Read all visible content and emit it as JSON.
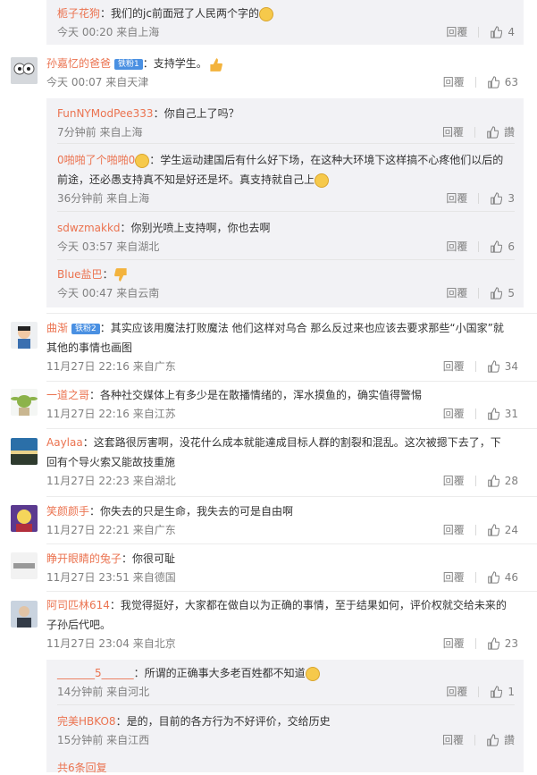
{
  "labels": {
    "reply": "回覆"
  },
  "colors": {
    "username": "#eb7350",
    "badge": "#4a90e2",
    "meta": "#808080"
  },
  "comments": [
    {
      "user": "栀子花狗",
      "text": "：我们的jc前面冠了人民两个字的",
      "time": "今天 00:20",
      "from": "来自上海",
      "likes": "4",
      "emoji": "smirk"
    },
    {
      "user": "孙嘉忆的爸爸",
      "badge": "铁粉1",
      "text": "：支持学生。",
      "time": "今天 00:07",
      "from": "来自天津",
      "likes": "63",
      "emoji": "thumbs-up",
      "replies": [
        {
          "user": "FunNYModPee333",
          "text": "：你自己上了吗？",
          "time": "7分钟前",
          "from": "来自上海",
          "likes": "讚"
        },
        {
          "user": "0啪啪了个啪啪0",
          "text": "：学生运动建国后有什么好下场，在这种大环境下这样搞不心疼他们以后的前途，还必愚支持真不知是好还是坏。真支持就自己上",
          "time": "36分钟前",
          "from": "来自上海",
          "likes": "3"
        },
        {
          "user": "sdwzmakkd",
          "text": "：你别光喷上支持啊，你也去啊",
          "time": "今天 03:57",
          "from": "来自湖北",
          "likes": "6"
        },
        {
          "user": "Blue盐巴",
          "text": "：",
          "time": "今天 00:47",
          "from": "来自云南",
          "likes": "5"
        }
      ]
    },
    {
      "user": "曲渐",
      "badge": "铁粉2",
      "text": "：其实应该用魔法打败魔法 他们这样对乌合 那么反过来也应该去要求那些“小国家”就其他的事情也画图",
      "time": "11月27日 22:16",
      "from": "来自广东",
      "likes": "34"
    },
    {
      "user": "一道之哥",
      "text": "：各种社交媒体上有多少是在散播情绪的，浑水摸鱼的，确实值得警惕",
      "time": "11月27日 22:16",
      "from": "来自江苏",
      "likes": "31"
    },
    {
      "user": "Aaylaa",
      "text": "：这套路很厉害啊，没花什么成本就能達成目标人群的割裂和混乱。这次被摁下去了，下回有个导火索又能故技重施",
      "time": "11月27日 22:23",
      "from": "来自湖北",
      "likes": "28"
    },
    {
      "user": "笑颜颜手",
      "text": "：你失去的只是生命，我失去的可是自由啊",
      "time": "11月27日 22:21",
      "from": "来自广东",
      "likes": "24"
    },
    {
      "user": "睁开眼睛的兔子",
      "text": "：你很可耻",
      "time": "11月27日 23:51",
      "from": "来自德国",
      "likes": "46"
    },
    {
      "user": "阿司匹林614",
      "text": "：我觉得挺好，大家都在做自以为正确的事情，至于结果如何，评价权就交给未来的子孙后代吧。",
      "time": "11月27日 23:04",
      "from": "来自北京",
      "likes": "23",
      "replies": [
        {
          "user": "_______5______",
          "text": "：所谓的正确事大多老百姓都不知道",
          "time": "14分钟前",
          "from": "来自河北",
          "likes": "1"
        },
        {
          "user": "完美HBKO8",
          "text": "：是的，目前的各方行为不好评价，交给历史",
          "time": "15分钟前",
          "from": "来自江西",
          "likes": "讚"
        }
      ],
      "more": "共6条回复"
    }
  ]
}
